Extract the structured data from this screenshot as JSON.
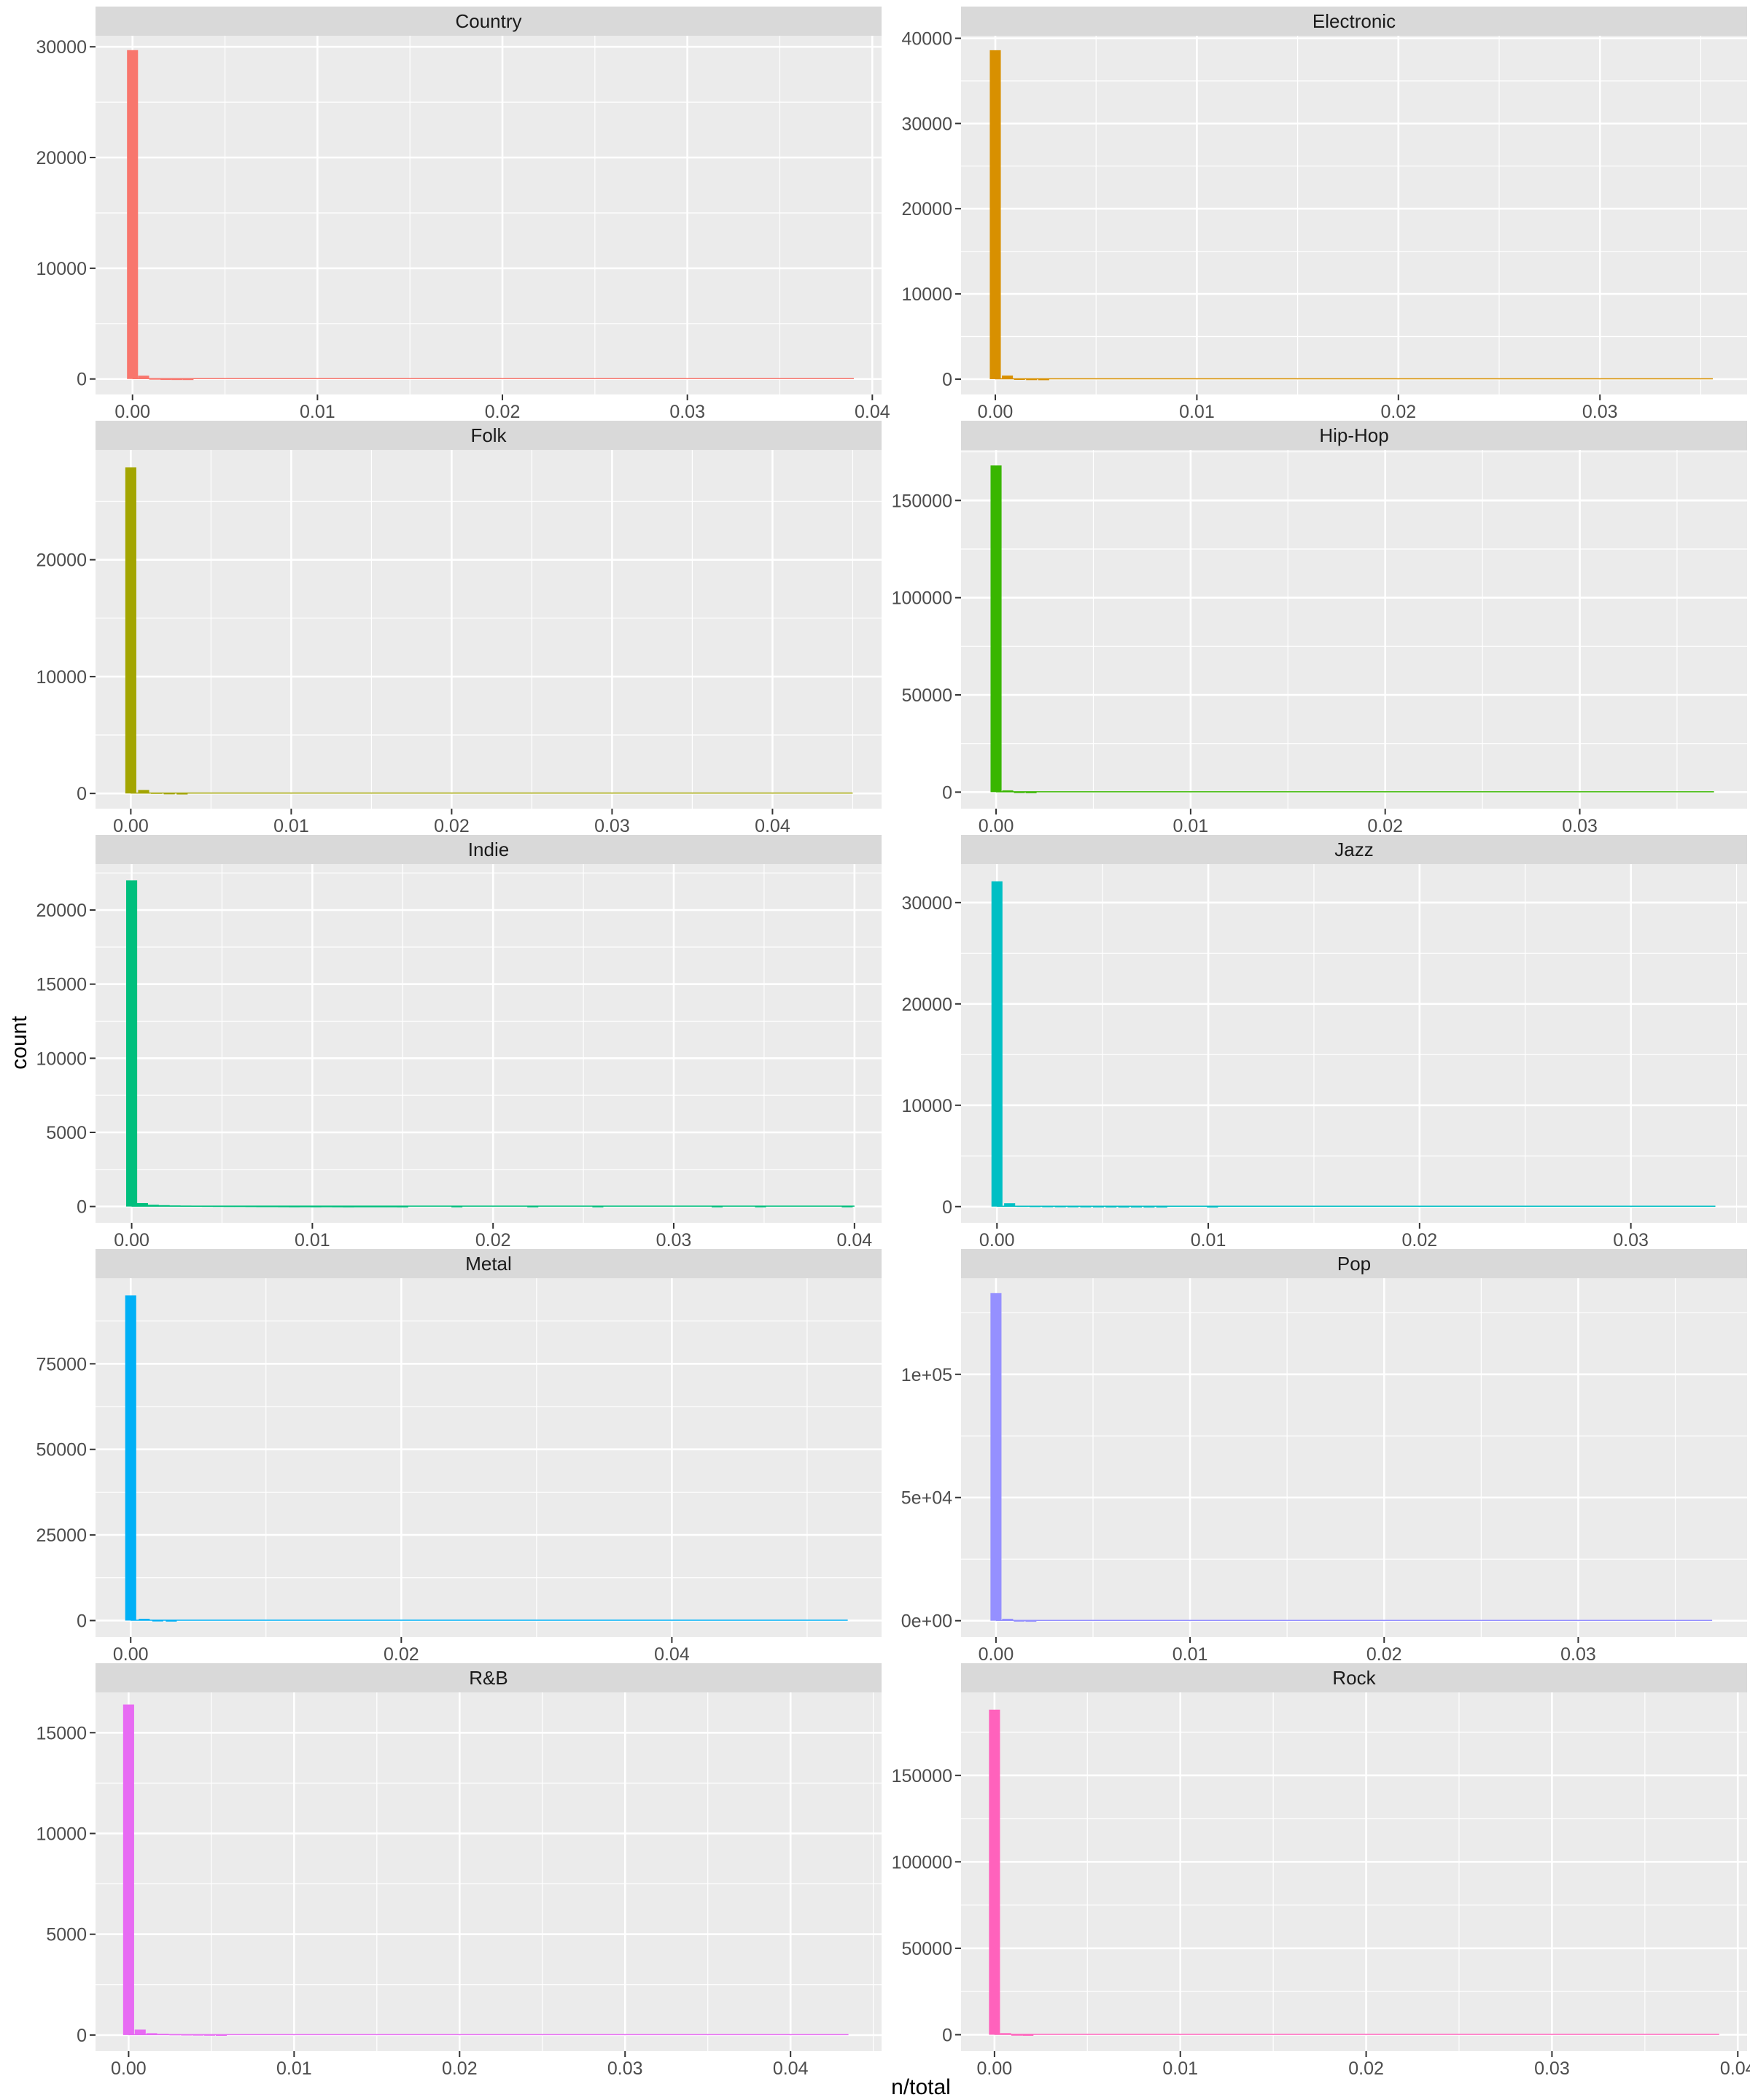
{
  "figure": {
    "xlabel": "n/total",
    "ylabel": "count"
  },
  "chart_data": [
    {
      "type": "bar",
      "facet": "Country",
      "color": "#F8766D",
      "xlim": [
        -0.002,
        0.0405
      ],
      "ylim": [
        -1400,
        31000
      ],
      "x_ticks": [
        0,
        0.01,
        0.02,
        0.03,
        0.04
      ],
      "x_tick_labels": [
        "0.00",
        "0.01",
        "0.02",
        "0.03",
        "0.04"
      ],
      "y_ticks": [
        0,
        10000,
        20000,
        30000
      ],
      "y_tick_labels": [
        "0",
        "10000",
        "20000",
        "30000"
      ],
      "bins": [
        [
          0,
          29700
        ],
        [
          0.0006,
          300
        ],
        [
          0.0012,
          35
        ],
        [
          0.0018,
          12
        ],
        [
          0.0024,
          6
        ],
        [
          0.003,
          3
        ]
      ],
      "baseline_to": 0.039
    },
    {
      "type": "bar",
      "facet": "Electronic",
      "color": "#D89000",
      "xlim": [
        -0.0017,
        0.0373
      ],
      "ylim": [
        -1800,
        40300
      ],
      "x_ticks": [
        0,
        0.01,
        0.02,
        0.03
      ],
      "x_tick_labels": [
        "0.00",
        "0.01",
        "0.02",
        "0.03"
      ],
      "y_ticks": [
        0,
        10000,
        20000,
        30000,
        40000
      ],
      "y_tick_labels": [
        "0",
        "10000",
        "20000",
        "30000",
        "40000"
      ],
      "bins": [
        [
          0,
          38600
        ],
        [
          0.0006,
          420
        ],
        [
          0.0012,
          40
        ],
        [
          0.0018,
          15
        ],
        [
          0.0024,
          6
        ]
      ],
      "baseline_to": 0.0356
    },
    {
      "type": "bar",
      "facet": "Folk",
      "color": "#A3A500",
      "xlim": [
        -0.0022,
        0.0468
      ],
      "ylim": [
        -1300,
        29400
      ],
      "x_ticks": [
        0,
        0.01,
        0.02,
        0.03,
        0.04
      ],
      "x_tick_labels": [
        "0.00",
        "0.01",
        "0.02",
        "0.03",
        "0.04"
      ],
      "y_ticks": [
        0,
        10000,
        20000
      ],
      "y_tick_labels": [
        "0",
        "10000",
        "20000"
      ],
      "bins": [
        [
          0,
          27900
        ],
        [
          0.0008,
          300
        ],
        [
          0.0016,
          60
        ],
        [
          0.0024,
          20
        ],
        [
          0.0032,
          8
        ]
      ],
      "baseline_to": 0.045
    },
    {
      "type": "bar",
      "facet": "Hip-Hop",
      "color": "#39B600",
      "xlim": [
        -0.0018,
        0.0386
      ],
      "ylim": [
        -8500,
        176000
      ],
      "x_ticks": [
        0,
        0.01,
        0.02,
        0.03
      ],
      "x_tick_labels": [
        "0.00",
        "0.01",
        "0.02",
        "0.03"
      ],
      "y_ticks": [
        0,
        50000,
        100000,
        150000
      ],
      "y_tick_labels": [
        "0",
        "50000",
        "100000",
        "150000"
      ],
      "bins": [
        [
          0,
          168000
        ],
        [
          0.0006,
          900
        ],
        [
          0.0012,
          120
        ],
        [
          0.0018,
          40
        ]
      ],
      "baseline_to": 0.0369
    },
    {
      "type": "bar",
      "facet": "Indie",
      "color": "#00BF7D",
      "xlim": [
        -0.002,
        0.0415
      ],
      "ylim": [
        -1100,
        23100
      ],
      "x_ticks": [
        0,
        0.01,
        0.02,
        0.03,
        0.04
      ],
      "x_tick_labels": [
        "0.00",
        "0.01",
        "0.02",
        "0.03",
        "0.04"
      ],
      "y_ticks": [
        0,
        5000,
        10000,
        15000,
        20000
      ],
      "y_tick_labels": [
        "0",
        "5000",
        "10000",
        "15000",
        "20000"
      ],
      "bins": [
        [
          0,
          22000
        ],
        [
          0.0006,
          230
        ],
        [
          0.0012,
          120
        ],
        [
          0.0018,
          90
        ],
        [
          0.0024,
          70
        ],
        [
          0.003,
          60
        ],
        [
          0.0036,
          55
        ],
        [
          0.0042,
          50
        ],
        [
          0.0048,
          45
        ],
        [
          0.0054,
          40
        ],
        [
          0.006,
          40
        ],
        [
          0.0066,
          35
        ],
        [
          0.0072,
          30
        ],
        [
          0.0078,
          30
        ],
        [
          0.0084,
          25
        ],
        [
          0.009,
          20
        ],
        [
          0.0096,
          25
        ],
        [
          0.0102,
          20
        ],
        [
          0.0108,
          25
        ],
        [
          0.0114,
          20
        ],
        [
          0.012,
          15
        ],
        [
          0.0126,
          20
        ],
        [
          0.0132,
          20
        ],
        [
          0.0138,
          20
        ],
        [
          0.0144,
          20
        ],
        [
          0.015,
          15
        ],
        [
          0.018,
          20
        ],
        [
          0.0222,
          20
        ],
        [
          0.0258,
          20
        ],
        [
          0.0324,
          20
        ],
        [
          0.0348,
          20
        ],
        [
          0.0396,
          20
        ]
      ],
      "baseline_to": 0.04
    },
    {
      "type": "bar",
      "facet": "Jazz",
      "color": "#00BFC4",
      "xlim": [
        -0.0017,
        0.0355
      ],
      "ylim": [
        -1600,
        33800
      ],
      "x_ticks": [
        0,
        0.01,
        0.02,
        0.03
      ],
      "x_tick_labels": [
        "0.00",
        "0.01",
        "0.02",
        "0.03"
      ],
      "y_ticks": [
        0,
        10000,
        20000,
        30000
      ],
      "y_tick_labels": [
        "0",
        "10000",
        "20000",
        "30000"
      ],
      "bins": [
        [
          0,
          32100
        ],
        [
          0.0006,
          330
        ],
        [
          0.0012,
          80
        ],
        [
          0.0018,
          60
        ],
        [
          0.0024,
          45
        ],
        [
          0.003,
          40
        ],
        [
          0.0036,
          35
        ],
        [
          0.0042,
          30
        ],
        [
          0.0048,
          25
        ],
        [
          0.0054,
          20
        ],
        [
          0.006,
          15
        ],
        [
          0.0066,
          20
        ],
        [
          0.0072,
          15
        ],
        [
          0.0078,
          15
        ],
        [
          0.0102,
          15
        ]
      ],
      "baseline_to": 0.034
    },
    {
      "type": "bar",
      "facet": "Metal",
      "color": "#00B0F6",
      "xlim": [
        -0.0026,
        0.0555
      ],
      "ylim": [
        -4800,
        100000
      ],
      "x_ticks": [
        0,
        0.02,
        0.04
      ],
      "x_tick_labels": [
        "0.00",
        "0.02",
        "0.04"
      ],
      "y_ticks": [
        0,
        25000,
        50000,
        75000
      ],
      "y_tick_labels": [
        "0",
        "25000",
        "50000",
        "75000"
      ],
      "bins": [
        [
          0,
          95000
        ],
        [
          0.001,
          500
        ],
        [
          0.002,
          60
        ],
        [
          0.003,
          20
        ]
      ],
      "baseline_to": 0.053
    },
    {
      "type": "bar",
      "facet": "Pop",
      "color": "#9590FF",
      "xlim": [
        -0.0018,
        0.0387
      ],
      "ylim": [
        -6600,
        139000
      ],
      "x_ticks": [
        0,
        0.01,
        0.02,
        0.03
      ],
      "x_tick_labels": [
        "0.00",
        "0.01",
        "0.02",
        "0.03"
      ],
      "y_ticks": [
        0,
        50000,
        100000
      ],
      "y_tick_labels": [
        "0e+00",
        "5e+04",
        "1e+05"
      ],
      "bins": [
        [
          0,
          133000
        ],
        [
          0.0006,
          800
        ],
        [
          0.0012,
          80
        ],
        [
          0.0018,
          30
        ]
      ],
      "baseline_to": 0.0369
    },
    {
      "type": "bar",
      "facet": "R&B",
      "color": "#E76BF3",
      "xlim": [
        -0.002,
        0.0455
      ],
      "ylim": [
        -800,
        17000
      ],
      "x_ticks": [
        0,
        0.01,
        0.02,
        0.03,
        0.04
      ],
      "x_tick_labels": [
        "0.00",
        "0.01",
        "0.02",
        "0.03",
        "0.04"
      ],
      "y_ticks": [
        0,
        5000,
        10000,
        15000
      ],
      "y_tick_labels": [
        "0",
        "5000",
        "10000",
        "15000"
      ],
      "bins": [
        [
          0,
          16400
        ],
        [
          0.0007,
          270
        ],
        [
          0.0014,
          90
        ],
        [
          0.0021,
          60
        ],
        [
          0.0028,
          40
        ],
        [
          0.0035,
          30
        ],
        [
          0.0042,
          25
        ],
        [
          0.0049,
          20
        ],
        [
          0.0056,
          15
        ]
      ],
      "baseline_to": 0.0435
    },
    {
      "type": "bar",
      "facet": "Rock",
      "color": "#FF62BC",
      "xlim": [
        -0.0018,
        0.0405
      ],
      "ylim": [
        -9500,
        198000
      ],
      "x_ticks": [
        0,
        0.01,
        0.02,
        0.03,
        0.04
      ],
      "x_tick_labels": [
        "0.00",
        "0.01",
        "0.02",
        "0.03",
        "0.04"
      ],
      "y_ticks": [
        0,
        50000,
        100000,
        150000
      ],
      "y_tick_labels": [
        "0",
        "50000",
        "100000",
        "150000"
      ],
      "bins": [
        [
          0,
          188000
        ],
        [
          0.0006,
          900
        ],
        [
          0.0012,
          100
        ],
        [
          0.0018,
          30
        ]
      ],
      "baseline_to": 0.039
    }
  ]
}
